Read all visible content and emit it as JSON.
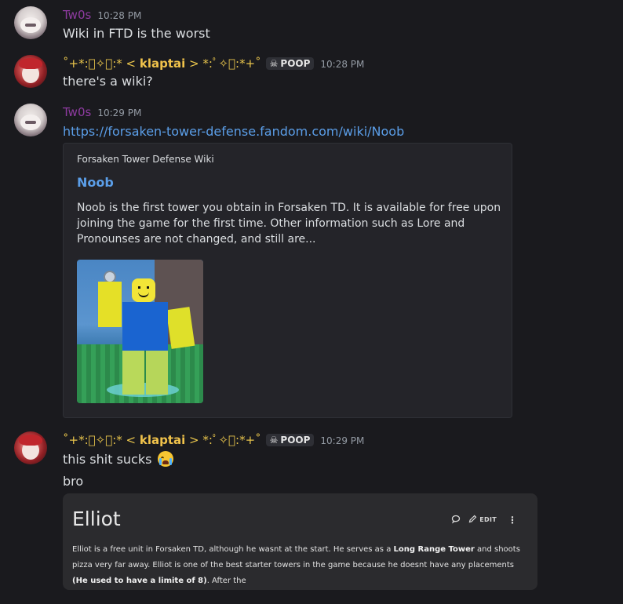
{
  "messages": [
    {
      "author": "Tw0s",
      "timestamp": "10:28 PM",
      "lines": [
        "Wiki in FTD is the worst"
      ]
    },
    {
      "author": "˚+*:ﾟ✧ﾟ:* < klaptai > *:ﾟ✧ﾟ:*+˚",
      "author_name": "klaptai",
      "author_prefix": "˚+*:ﾟ✧ﾟ:* < ",
      "author_suffix": " > *:ﾟ✧ﾟ:*+˚",
      "tag": "POOP",
      "tag_icon": "skull-icon",
      "timestamp": "10:28 PM",
      "lines": [
        "there's a wiki?"
      ]
    },
    {
      "author": "Tw0s",
      "timestamp": "10:29 PM",
      "link": "https://forsaken-tower-defense.fandom.com/wiki/Noob",
      "embed": {
        "provider": "Forsaken Tower Defense Wiki",
        "title": "Noob",
        "description": "Noob is the first tower you obtain in Forsaken TD. It is available for free upon joining the game for the first time. Other information such as Lore and Pronounses are not changed, and still are..."
      }
    },
    {
      "author_name": "klaptai",
      "author_prefix": "˚+*:ﾟ✧ﾟ:* < ",
      "author_suffix": " > *:ﾟ✧ﾟ:*+˚",
      "tag": "POOP",
      "timestamp": "10:29 PM",
      "lines": [
        "this shit sucks",
        "bro"
      ],
      "emoji": "loudly-crying-face",
      "card": {
        "title": "Elliot",
        "edit_label": "EDIT",
        "desc_1": "Elliot is a free unit in Forsaken TD, although he wasnt at the start. He serves as a ",
        "desc_bold_1": "Long Range Tower",
        "desc_2": " and shoots pizza very far away. Elliot is one of the best starter towers in the game because he doesnt have any placements ",
        "desc_bold_2": "(He used to have a limite of 8)",
        "desc_3": ". After the"
      }
    }
  ],
  "colors": {
    "background": "#1a1a1e",
    "tw0s_name": "#8e3ba0",
    "klaptai_name": "#f0c24b",
    "link": "#5b9ee8",
    "timestamp": "#949ba4"
  }
}
